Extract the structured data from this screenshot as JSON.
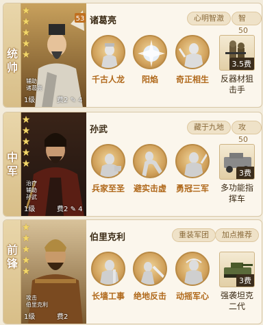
{
  "generals": [
    {
      "name": "诸葛亮",
      "role": [
        "统",
        "帅"
      ],
      "stars": 5,
      "tags": [
        "辅助",
        "诸葛亮"
      ],
      "level": "1级",
      "cost": "费2",
      "extra": "4",
      "badges": [
        "心明智澈",
        "智50"
      ],
      "skills": [
        "千古人龙",
        "阳焰",
        "奇正相生"
      ],
      "equipment": {
        "cost": "3.5费",
        "name": "反器材狙击手"
      }
    },
    {
      "name": "孙武",
      "role": [
        "中",
        "军"
      ],
      "stars": 5,
      "tags": [
        "治疗",
        "辅助",
        "孙武"
      ],
      "level": "1级",
      "cost": "费2",
      "extra": "4",
      "badges": [
        "藏于九地",
        "攻50"
      ],
      "skills": [
        "兵家至圣",
        "避实击虚",
        "勇冠三军"
      ],
      "equipment": {
        "cost": "3费",
        "name": "多功能指挥车"
      }
    },
    {
      "name": "伯里克利",
      "role": [
        "前",
        "锋"
      ],
      "stars": 5,
      "tags": [
        "攻击",
        "伯里克利"
      ],
      "level": "1级",
      "cost": "费2",
      "extra": "",
      "badges": [
        "重装军团",
        "加点推荐"
      ],
      "skills": [
        "长墙工事",
        "绝地反击",
        "动摇军心"
      ],
      "equipment": {
        "cost": "3费",
        "name": "强袭坦克二代"
      }
    }
  ],
  "colors": {
    "accent": "#b0691b",
    "badge_bg": "#efe2c8",
    "role_strip": "#d8be88"
  },
  "icons": {
    "star": "star-icon",
    "skill": "skill-icon",
    "equipment": "equipment-icon"
  }
}
